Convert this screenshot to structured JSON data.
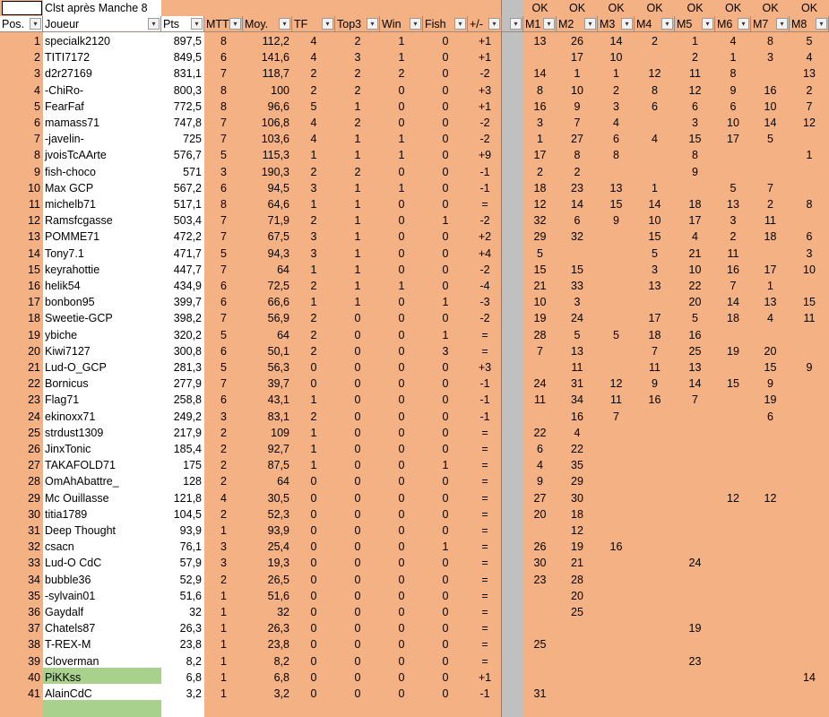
{
  "sheet": {
    "title": "Clst après Manche 8",
    "ok_label": "OK",
    "headers": {
      "pos": "Pos.",
      "joueur": "Joueur",
      "pts": "Pts",
      "mtt": "MTT",
      "moy": "Moy.",
      "tf": "TF",
      "top3": "Top3",
      "win": "Win",
      "fish": "Fish",
      "delta": "+/-",
      "rounds": [
        "M1",
        "M2",
        "M3",
        "M4",
        "M5",
        "M6",
        "M7",
        "M8"
      ]
    },
    "colors": {
      "orange": "#f4b183",
      "white": "#ffffff",
      "green": "#a9d18e",
      "grey": "#c0c0c0"
    },
    "rows": [
      [
        "1",
        "specialk2120",
        "897,5",
        "8",
        "112,2",
        "4",
        "2",
        "1",
        "0",
        "+1",
        "13",
        "26",
        "14",
        "2",
        "1",
        "4",
        "8",
        "5"
      ],
      [
        "2",
        "TITI7172",
        "849,5",
        "6",
        "141,6",
        "4",
        "3",
        "1",
        "0",
        "+1",
        "",
        "17",
        "10",
        "",
        "2",
        "1",
        "3",
        "4"
      ],
      [
        "3",
        "d2r27169",
        "831,1",
        "7",
        "118,7",
        "2",
        "2",
        "2",
        "0",
        "-2",
        "14",
        "1",
        "1",
        "12",
        "11",
        "8",
        "",
        "13"
      ],
      [
        "4",
        "-ChiRo-",
        "800,3",
        "8",
        "100",
        "2",
        "2",
        "0",
        "0",
        "+3",
        "8",
        "10",
        "2",
        "8",
        "12",
        "9",
        "16",
        "2"
      ],
      [
        "5",
        "FearFaf",
        "772,5",
        "8",
        "96,6",
        "5",
        "1",
        "0",
        "0",
        "+1",
        "16",
        "9",
        "3",
        "6",
        "6",
        "6",
        "10",
        "7"
      ],
      [
        "6",
        "mamass71",
        "747,8",
        "7",
        "106,8",
        "4",
        "2",
        "0",
        "0",
        "-2",
        "3",
        "7",
        "4",
        "",
        "3",
        "10",
        "14",
        "12"
      ],
      [
        "7",
        "-javelin-",
        "725",
        "7",
        "103,6",
        "4",
        "1",
        "1",
        "0",
        "-2",
        "1",
        "27",
        "6",
        "4",
        "15",
        "17",
        "5",
        ""
      ],
      [
        "8",
        "jvoisTcAArte",
        "576,7",
        "5",
        "115,3",
        "1",
        "1",
        "1",
        "0",
        "+9",
        "17",
        "8",
        "8",
        "",
        "8",
        "",
        "",
        "1"
      ],
      [
        "9",
        "fish-choco",
        "571",
        "3",
        "190,3",
        "2",
        "2",
        "0",
        "0",
        "-1",
        "2",
        "2",
        "",
        "",
        "9",
        "",
        "",
        ""
      ],
      [
        "10",
        "Max GCP",
        "567,2",
        "6",
        "94,5",
        "3",
        "1",
        "1",
        "0",
        "-1",
        "18",
        "23",
        "13",
        "1",
        "",
        "5",
        "7",
        ""
      ],
      [
        "11",
        "michelb71",
        "517,1",
        "8",
        "64,6",
        "1",
        "1",
        "0",
        "0",
        "=",
        "12",
        "14",
        "15",
        "14",
        "18",
        "13",
        "2",
        "8"
      ],
      [
        "12",
        "Ramsfcgasse",
        "503,4",
        "7",
        "71,9",
        "2",
        "1",
        "0",
        "1",
        "-2",
        "32",
        "6",
        "9",
        "10",
        "17",
        "3",
        "11",
        ""
      ],
      [
        "13",
        "POMME71",
        "472,2",
        "7",
        "67,5",
        "3",
        "1",
        "0",
        "0",
        "+2",
        "29",
        "32",
        "",
        "15",
        "4",
        "2",
        "18",
        "6"
      ],
      [
        "14",
        "Tony7.1",
        "471,7",
        "5",
        "94,3",
        "3",
        "1",
        "0",
        "0",
        "+4",
        "5",
        "",
        "",
        "5",
        "21",
        "11",
        "",
        "3"
      ],
      [
        "15",
        "keyrahottie",
        "447,7",
        "7",
        "64",
        "1",
        "1",
        "0",
        "0",
        "-2",
        "15",
        "15",
        "",
        "3",
        "10",
        "16",
        "17",
        "10"
      ],
      [
        "16",
        "helik54",
        "434,9",
        "6",
        "72,5",
        "2",
        "1",
        "1",
        "0",
        "-4",
        "21",
        "33",
        "",
        "13",
        "22",
        "7",
        "1",
        ""
      ],
      [
        "17",
        "bonbon95",
        "399,7",
        "6",
        "66,6",
        "1",
        "1",
        "0",
        "1",
        "-3",
        "10",
        "3",
        "",
        "",
        "20",
        "14",
        "13",
        "15"
      ],
      [
        "18",
        "Sweetie-GCP",
        "398,2",
        "7",
        "56,9",
        "2",
        "0",
        "0",
        "0",
        "-2",
        "19",
        "24",
        "",
        "17",
        "5",
        "18",
        "4",
        "11"
      ],
      [
        "19",
        "ybiche",
        "320,2",
        "5",
        "64",
        "2",
        "0",
        "0",
        "1",
        "=",
        "28",
        "5",
        "5",
        "18",
        "16",
        "",
        "",
        ""
      ],
      [
        "20",
        "Kiwi7127",
        "300,8",
        "6",
        "50,1",
        "2",
        "0",
        "0",
        "3",
        "=",
        "7",
        "13",
        "",
        "7",
        "25",
        "19",
        "20",
        ""
      ],
      [
        "21",
        "Lud-O_GCP",
        "281,3",
        "5",
        "56,3",
        "0",
        "0",
        "0",
        "0",
        "+3",
        "",
        "11",
        "",
        "11",
        "13",
        "",
        "15",
        "9"
      ],
      [
        "22",
        "Bornicus",
        "277,9",
        "7",
        "39,7",
        "0",
        "0",
        "0",
        "0",
        "-1",
        "24",
        "31",
        "12",
        "9",
        "14",
        "15",
        "9",
        ""
      ],
      [
        "23",
        "Flag71",
        "258,8",
        "6",
        "43,1",
        "1",
        "0",
        "0",
        "0",
        "-1",
        "11",
        "34",
        "11",
        "16",
        "7",
        "",
        "19",
        ""
      ],
      [
        "24",
        "ekinoxx71",
        "249,2",
        "3",
        "83,1",
        "2",
        "0",
        "0",
        "0",
        "-1",
        "",
        "16",
        "7",
        "",
        "",
        "",
        "6",
        ""
      ],
      [
        "25",
        "strdust1309",
        "217,9",
        "2",
        "109",
        "1",
        "0",
        "0",
        "0",
        "=",
        "22",
        "4",
        "",
        "",
        "",
        "",
        "",
        ""
      ],
      [
        "26",
        "JinxTonic",
        "185,4",
        "2",
        "92,7",
        "1",
        "0",
        "0",
        "0",
        "=",
        "6",
        "22",
        "",
        "",
        "",
        "",
        "",
        ""
      ],
      [
        "27",
        "TAKAFOLD71",
        "175",
        "2",
        "87,5",
        "1",
        "0",
        "0",
        "1",
        "=",
        "4",
        "35",
        "",
        "",
        "",
        "",
        "",
        ""
      ],
      [
        "28",
        "OmAhAbattre_",
        "128",
        "2",
        "64",
        "0",
        "0",
        "0",
        "0",
        "=",
        "9",
        "29",
        "",
        "",
        "",
        "",
        "",
        ""
      ],
      [
        "29",
        "Mc Ouillasse",
        "121,8",
        "4",
        "30,5",
        "0",
        "0",
        "0",
        "0",
        "=",
        "27",
        "30",
        "",
        "",
        "",
        "12",
        "12",
        ""
      ],
      [
        "30",
        "titia1789",
        "104,5",
        "2",
        "52,3",
        "0",
        "0",
        "0",
        "0",
        "=",
        "20",
        "18",
        "",
        "",
        "",
        "",
        "",
        ""
      ],
      [
        "31",
        "Deep Thought",
        "93,9",
        "1",
        "93,9",
        "0",
        "0",
        "0",
        "0",
        "=",
        "",
        "12",
        "",
        "",
        "",
        "",
        "",
        ""
      ],
      [
        "32",
        "csacn",
        "76,1",
        "3",
        "25,4",
        "0",
        "0",
        "0",
        "1",
        "=",
        "26",
        "19",
        "16",
        "",
        "",
        "",
        "",
        ""
      ],
      [
        "33",
        "Lud-O CdC",
        "57,9",
        "3",
        "19,3",
        "0",
        "0",
        "0",
        "0",
        "=",
        "30",
        "21",
        "",
        "",
        "24",
        "",
        "",
        ""
      ],
      [
        "34",
        "bubble36",
        "52,9",
        "2",
        "26,5",
        "0",
        "0",
        "0",
        "0",
        "=",
        "23",
        "28",
        "",
        "",
        "",
        "",
        "",
        ""
      ],
      [
        "35",
        "-sylvain01",
        "51,6",
        "1",
        "51,6",
        "0",
        "0",
        "0",
        "0",
        "=",
        "",
        "20",
        "",
        "",
        "",
        "",
        "",
        ""
      ],
      [
        "36",
        "Gaydalf",
        "32",
        "1",
        "32",
        "0",
        "0",
        "0",
        "0",
        "=",
        "",
        "25",
        "",
        "",
        "",
        "",
        "",
        ""
      ],
      [
        "37",
        "Chatels87",
        "26,3",
        "1",
        "26,3",
        "0",
        "0",
        "0",
        "0",
        "=",
        "",
        "",
        "",
        "",
        "19",
        "",
        "",
        ""
      ],
      [
        "38",
        "T-REX-M",
        "23,8",
        "1",
        "23,8",
        "0",
        "0",
        "0",
        "0",
        "=",
        "25",
        "",
        "",
        "",
        "",
        "",
        "",
        ""
      ],
      [
        "39",
        "Cloverman",
        "8,2",
        "1",
        "8,2",
        "0",
        "0",
        "0",
        "0",
        "=",
        "",
        "",
        "",
        "",
        "23",
        "",
        "",
        ""
      ],
      [
        "40",
        "PiKKss",
        "6,8",
        "1",
        "6,8",
        "0",
        "0",
        "0",
        "0",
        "+1",
        "",
        "",
        "",
        "",
        "",
        "",
        "",
        "14"
      ],
      [
        "41",
        "AlainCdC",
        "3,2",
        "1",
        "3,2",
        "0",
        "0",
        "0",
        "0",
        "-1",
        "31",
        "",
        "",
        "",
        "",
        "",
        "",
        ""
      ]
    ],
    "highlight_rows": [
      40
    ]
  }
}
